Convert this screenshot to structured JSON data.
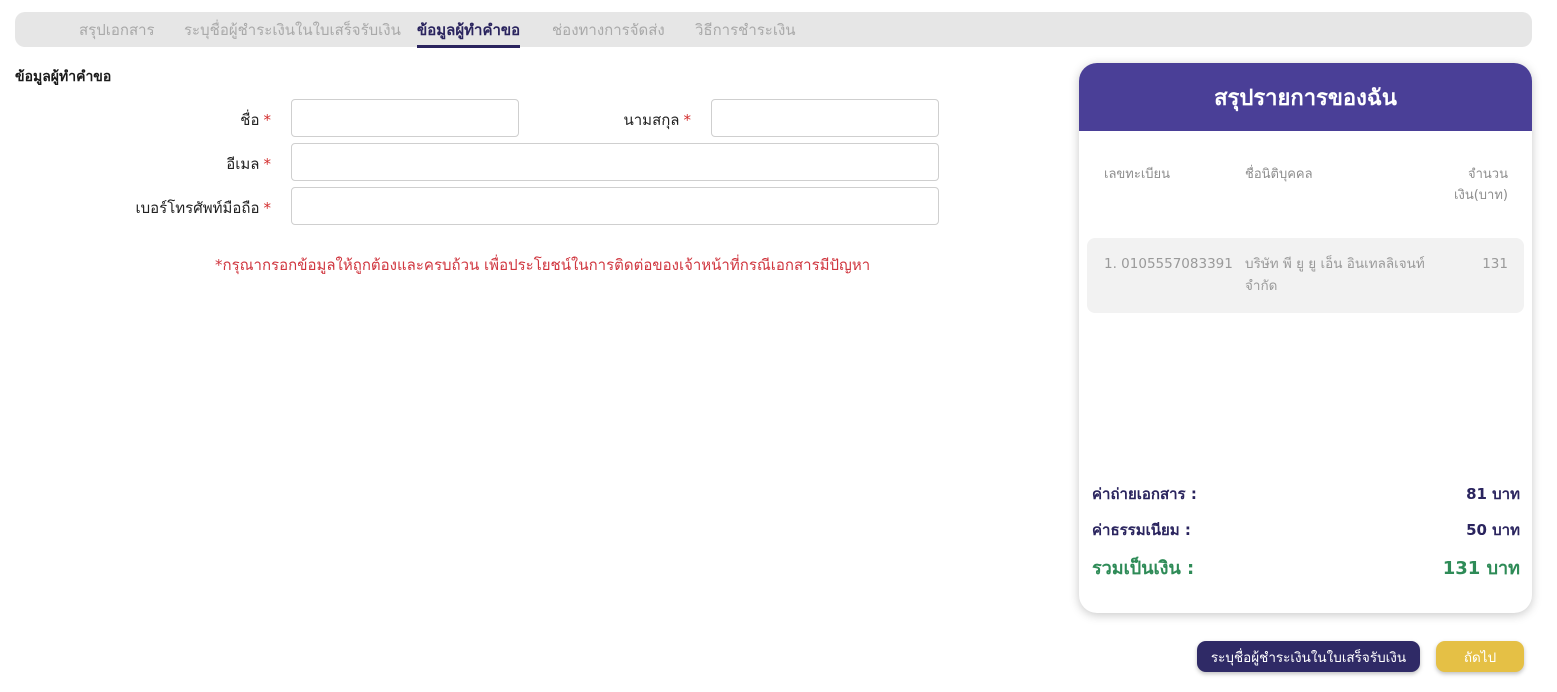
{
  "steps": [
    {
      "label": "สรุปเอกสาร",
      "active": false
    },
    {
      "label": "ระบุชื่อผู้ชำระเงินในใบเสร็จรับเงิน",
      "active": false
    },
    {
      "label": "ข้อมูลผู้ทำคำขอ",
      "active": true
    },
    {
      "label": "ช่องทางการจัดส่ง",
      "active": false
    },
    {
      "label": "วิธีการชำระเงิน",
      "active": false
    }
  ],
  "form": {
    "title": "ข้อมูลผู้ทำคำขอ",
    "first_name": {
      "label": "ชื่อ",
      "value": ""
    },
    "last_name": {
      "label": "นามสกุล",
      "value": ""
    },
    "email": {
      "label": "อีเมล",
      "value": ""
    },
    "phone": {
      "label": "เบอร์โทรศัพท์มือถือ",
      "value": ""
    },
    "required_mark": "*",
    "note": "*กรุณากรอกข้อมูลให้ถูกต้องและครบถ้วน เพื่อประโยชน์ในการติดต่อของเจ้าหน้าที่กรณีเอกสารมีปัญหา"
  },
  "summary": {
    "title": "สรุปรายการของฉัน",
    "columns": {
      "reg_no": "เลขทะเบียน",
      "company": "ชื่อนิติบุคคล",
      "amount_line1": "จำนวน",
      "amount_line2": "เงิน(บาท)"
    },
    "items": [
      {
        "reg_no": "1. 0105557083391",
        "company_line1": "บริษัท พี ยู ยู เอ็น อินเทลลิเจนท์",
        "company_line2": "จำกัด",
        "amount": "131"
      }
    ],
    "copy_fee": {
      "label": "ค่าถ่ายเอกสาร :",
      "value": "81 บาท"
    },
    "service_fee": {
      "label": "ค่าธรรมเนียม :",
      "value": "50 บาท"
    },
    "total": {
      "label": "รวมเป็นเงิน :",
      "value": "131 บาท"
    }
  },
  "buttons": {
    "back": "ระบุชื่อผู้ชำระเงินในใบเสร็จรับเงิน",
    "next": "ถัดไป"
  },
  "colors": {
    "accent": "#4a3f97",
    "navy": "#2a245e",
    "error": "#d0363f",
    "total": "#2e8b57",
    "next_button": "#e5c045"
  }
}
